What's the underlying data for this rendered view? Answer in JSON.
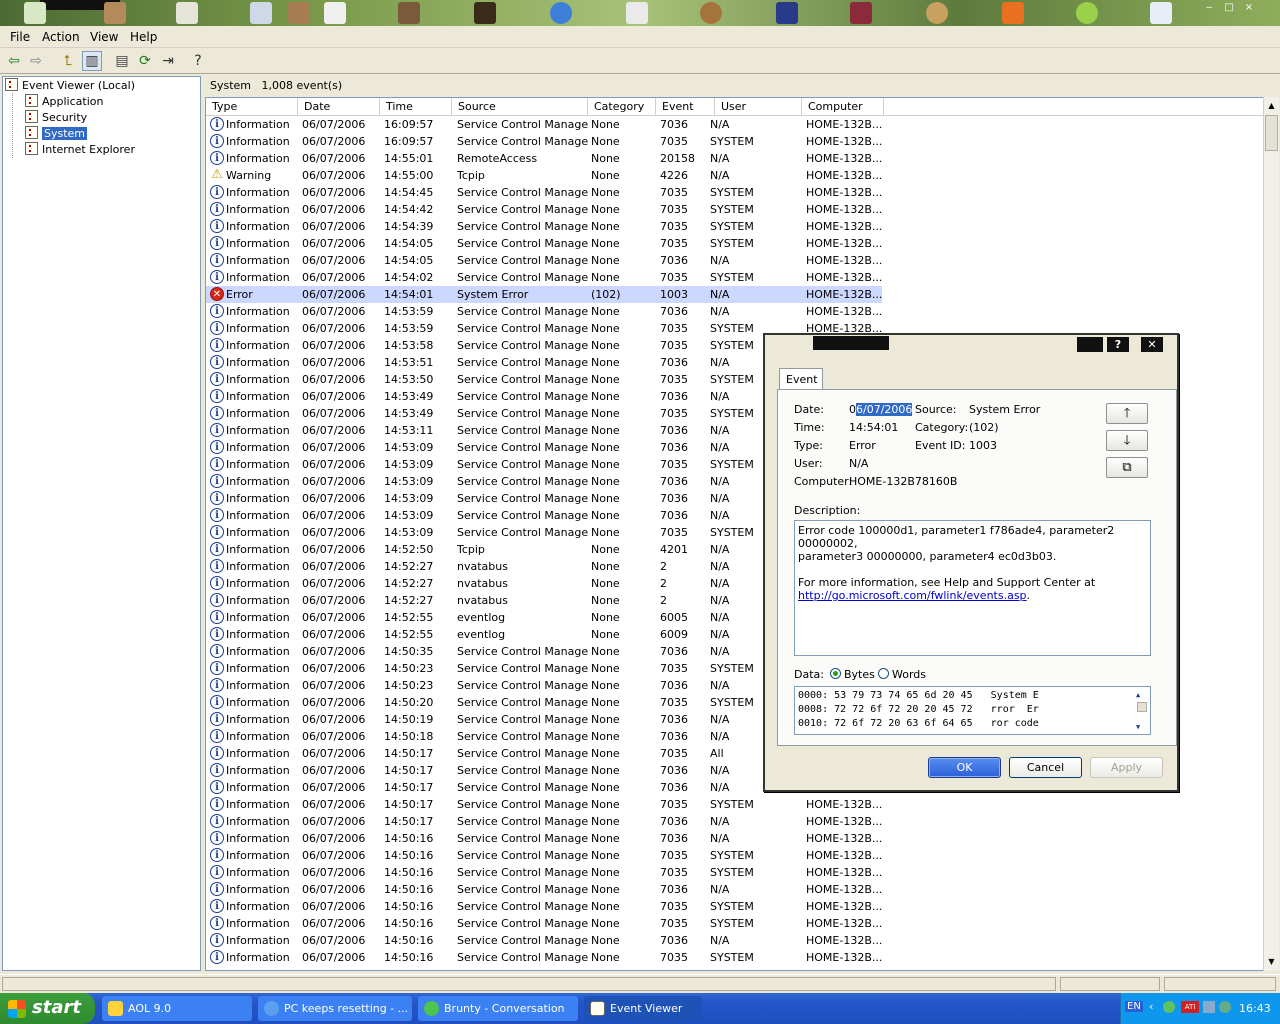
{
  "menu": {
    "file": "File",
    "action": "Action",
    "view": "View",
    "help": "Help"
  },
  "toolbar_icons": [
    "back-arrow-icon",
    "forward-arrow-icon",
    "up-folder-icon",
    "show-hide-tree-icon",
    "properties-icon",
    "refresh-icon",
    "export-list-icon",
    "help-icon"
  ],
  "tree": {
    "root": "Event Viewer (Local)",
    "items": [
      {
        "label": "Application"
      },
      {
        "label": "Security"
      },
      {
        "label": "System"
      },
      {
        "label": "Internet Explorer"
      }
    ]
  },
  "panel": {
    "name": "System",
    "count": "1,008 event(s)"
  },
  "columns": {
    "type": "Type",
    "date": "Date",
    "time": "Time",
    "source": "Source",
    "category": "Category",
    "event": "Event",
    "user": "User",
    "computer": "Computer"
  },
  "events": [
    [
      "info",
      "Information",
      "06/07/2006",
      "16:09:57",
      "Service Control Manager",
      "None",
      "7036",
      "N/A",
      "HOME-132B..."
    ],
    [
      "info",
      "Information",
      "06/07/2006",
      "16:09:57",
      "Service Control Manager",
      "None",
      "7035",
      "SYSTEM",
      "HOME-132B..."
    ],
    [
      "info",
      "Information",
      "06/07/2006",
      "14:55:01",
      "RemoteAccess",
      "None",
      "20158",
      "N/A",
      "HOME-132B..."
    ],
    [
      "warn",
      "Warning",
      "06/07/2006",
      "14:55:00",
      "Tcpip",
      "None",
      "4226",
      "N/A",
      "HOME-132B..."
    ],
    [
      "info",
      "Information",
      "06/07/2006",
      "14:54:45",
      "Service Control Manager",
      "None",
      "7035",
      "SYSTEM",
      "HOME-132B..."
    ],
    [
      "info",
      "Information",
      "06/07/2006",
      "14:54:42",
      "Service Control Manager",
      "None",
      "7035",
      "SYSTEM",
      "HOME-132B..."
    ],
    [
      "info",
      "Information",
      "06/07/2006",
      "14:54:39",
      "Service Control Manager",
      "None",
      "7035",
      "SYSTEM",
      "HOME-132B..."
    ],
    [
      "info",
      "Information",
      "06/07/2006",
      "14:54:05",
      "Service Control Manager",
      "None",
      "7035",
      "SYSTEM",
      "HOME-132B..."
    ],
    [
      "info",
      "Information",
      "06/07/2006",
      "14:54:05",
      "Service Control Manager",
      "None",
      "7036",
      "N/A",
      "HOME-132B..."
    ],
    [
      "info",
      "Information",
      "06/07/2006",
      "14:54:02",
      "Service Control Manager",
      "None",
      "7035",
      "SYSTEM",
      "HOME-132B..."
    ],
    [
      "err",
      "Error",
      "06/07/2006",
      "14:54:01",
      "System Error",
      "(102)",
      "1003",
      "N/A",
      "HOME-132B..."
    ],
    [
      "info",
      "Information",
      "06/07/2006",
      "14:53:59",
      "Service Control Manager",
      "None",
      "7036",
      "N/A",
      "HOME-132B..."
    ],
    [
      "info",
      "Information",
      "06/07/2006",
      "14:53:59",
      "Service Control Manager",
      "None",
      "7035",
      "SYSTEM",
      "HOME-132B..."
    ],
    [
      "info",
      "Information",
      "06/07/2006",
      "14:53:58",
      "Service Control Manager",
      "None",
      "7035",
      "SYSTEM",
      ""
    ],
    [
      "info",
      "Information",
      "06/07/2006",
      "14:53:51",
      "Service Control Manager",
      "None",
      "7036",
      "N/A",
      ""
    ],
    [
      "info",
      "Information",
      "06/07/2006",
      "14:53:50",
      "Service Control Manager",
      "None",
      "7035",
      "SYSTEM",
      ""
    ],
    [
      "info",
      "Information",
      "06/07/2006",
      "14:53:49",
      "Service Control Manager",
      "None",
      "7036",
      "N/A",
      ""
    ],
    [
      "info",
      "Information",
      "06/07/2006",
      "14:53:49",
      "Service Control Manager",
      "None",
      "7035",
      "SYSTEM",
      ""
    ],
    [
      "info",
      "Information",
      "06/07/2006",
      "14:53:11",
      "Service Control Manager",
      "None",
      "7036",
      "N/A",
      ""
    ],
    [
      "info",
      "Information",
      "06/07/2006",
      "14:53:09",
      "Service Control Manager",
      "None",
      "7036",
      "N/A",
      ""
    ],
    [
      "info",
      "Information",
      "06/07/2006",
      "14:53:09",
      "Service Control Manager",
      "None",
      "7035",
      "SYSTEM",
      ""
    ],
    [
      "info",
      "Information",
      "06/07/2006",
      "14:53:09",
      "Service Control Manager",
      "None",
      "7036",
      "N/A",
      ""
    ],
    [
      "info",
      "Information",
      "06/07/2006",
      "14:53:09",
      "Service Control Manager",
      "None",
      "7036",
      "N/A",
      ""
    ],
    [
      "info",
      "Information",
      "06/07/2006",
      "14:53:09",
      "Service Control Manager",
      "None",
      "7036",
      "N/A",
      ""
    ],
    [
      "info",
      "Information",
      "06/07/2006",
      "14:53:09",
      "Service Control Manager",
      "None",
      "7035",
      "SYSTEM",
      ""
    ],
    [
      "info",
      "Information",
      "06/07/2006",
      "14:52:50",
      "Tcpip",
      "None",
      "4201",
      "N/A",
      ""
    ],
    [
      "info",
      "Information",
      "06/07/2006",
      "14:52:27",
      "nvatabus",
      "None",
      "2",
      "N/A",
      ""
    ],
    [
      "info",
      "Information",
      "06/07/2006",
      "14:52:27",
      "nvatabus",
      "None",
      "2",
      "N/A",
      ""
    ],
    [
      "info",
      "Information",
      "06/07/2006",
      "14:52:27",
      "nvatabus",
      "None",
      "2",
      "N/A",
      ""
    ],
    [
      "info",
      "Information",
      "06/07/2006",
      "14:52:55",
      "eventlog",
      "None",
      "6005",
      "N/A",
      ""
    ],
    [
      "info",
      "Information",
      "06/07/2006",
      "14:52:55",
      "eventlog",
      "None",
      "6009",
      "N/A",
      ""
    ],
    [
      "info",
      "Information",
      "06/07/2006",
      "14:50:35",
      "Service Control Manager",
      "None",
      "7036",
      "N/A",
      ""
    ],
    [
      "info",
      "Information",
      "06/07/2006",
      "14:50:23",
      "Service Control Manager",
      "None",
      "7035",
      "SYSTEM",
      ""
    ],
    [
      "info",
      "Information",
      "06/07/2006",
      "14:50:23",
      "Service Control Manager",
      "None",
      "7036",
      "N/A",
      ""
    ],
    [
      "info",
      "Information",
      "06/07/2006",
      "14:50:20",
      "Service Control Manager",
      "None",
      "7035",
      "SYSTEM",
      ""
    ],
    [
      "info",
      "Information",
      "06/07/2006",
      "14:50:19",
      "Service Control Manager",
      "None",
      "7036",
      "N/A",
      ""
    ],
    [
      "info",
      "Information",
      "06/07/2006",
      "14:50:18",
      "Service Control Manager",
      "None",
      "7036",
      "N/A",
      ""
    ],
    [
      "info",
      "Information",
      "06/07/2006",
      "14:50:17",
      "Service Control Manager",
      "None",
      "7035",
      "All",
      ""
    ],
    [
      "info",
      "Information",
      "06/07/2006",
      "14:50:17",
      "Service Control Manager",
      "None",
      "7036",
      "N/A",
      ""
    ],
    [
      "info",
      "Information",
      "06/07/2006",
      "14:50:17",
      "Service Control Manager",
      "None",
      "7036",
      "N/A",
      ""
    ],
    [
      "info",
      "Information",
      "06/07/2006",
      "14:50:17",
      "Service Control Manager",
      "None",
      "7035",
      "SYSTEM",
      "HOME-132B..."
    ],
    [
      "info",
      "Information",
      "06/07/2006",
      "14:50:17",
      "Service Control Manager",
      "None",
      "7036",
      "N/A",
      "HOME-132B..."
    ],
    [
      "info",
      "Information",
      "06/07/2006",
      "14:50:16",
      "Service Control Manager",
      "None",
      "7036",
      "N/A",
      "HOME-132B..."
    ],
    [
      "info",
      "Information",
      "06/07/2006",
      "14:50:16",
      "Service Control Manager",
      "None",
      "7035",
      "SYSTEM",
      "HOME-132B..."
    ],
    [
      "info",
      "Information",
      "06/07/2006",
      "14:50:16",
      "Service Control Manager",
      "None",
      "7035",
      "SYSTEM",
      "HOME-132B..."
    ],
    [
      "info",
      "Information",
      "06/07/2006",
      "14:50:16",
      "Service Control Manager",
      "None",
      "7036",
      "N/A",
      "HOME-132B..."
    ],
    [
      "info",
      "Information",
      "06/07/2006",
      "14:50:16",
      "Service Control Manager",
      "None",
      "7035",
      "SYSTEM",
      "HOME-132B..."
    ],
    [
      "info",
      "Information",
      "06/07/2006",
      "14:50:16",
      "Service Control Manager",
      "None",
      "7035",
      "SYSTEM",
      "HOME-132B..."
    ],
    [
      "info",
      "Information",
      "06/07/2006",
      "14:50:16",
      "Service Control Manager",
      "None",
      "7036",
      "N/A",
      "HOME-132B..."
    ],
    [
      "info",
      "Information",
      "06/07/2006",
      "14:50:16",
      "Service Control Manager",
      "None",
      "7035",
      "SYSTEM",
      "HOME-132B..."
    ]
  ],
  "selected_row": 10,
  "dialog": {
    "tab": "Event",
    "date_label": "Date:",
    "date_value_a": "0",
    "date_value_b": "6/07/2006",
    "source_label": "Source:",
    "source_value": "System Error",
    "time_label": "Time:",
    "time_value": "14:54:01",
    "category_label": "Category:",
    "category_value": "(102)",
    "type_label": "Type:",
    "type_value": "Error",
    "eventid_label": "Event ID:",
    "eventid_value": "1003",
    "user_label": "User:",
    "user_value": "N/A",
    "computer_label": "Computer:",
    "computer_value": "HOME-132B78160B",
    "description_label": "Description:",
    "description_line1": "Error code 100000d1, parameter1 f786ade4, parameter2 00000002,",
    "description_line2": "parameter3 00000000, parameter4 ec0d3b03.",
    "description_line3": "For more information, see Help and Support Center at",
    "description_link": "http://go.microsoft.com/fwlink/events.asp",
    "description_end": ".",
    "data_label": "Data:",
    "bytes_label": "Bytes",
    "words_label": "Words",
    "hex_lines": [
      "0000: 53 79 73 74 65 6d 20 45   System E",
      "0008: 72 72 6f 72 20 20 45 72   rror  Er",
      "0010: 72 6f 72 20 63 6f 64 65   ror code"
    ],
    "ok": "OK",
    "cancel": "Cancel",
    "apply": "Apply"
  },
  "taskbar": {
    "start": "start",
    "tasks": [
      {
        "label": "AOL 9.0"
      },
      {
        "label": "PC keeps resetting - ..."
      },
      {
        "label": "Brunty - Conversation"
      },
      {
        "label": "Event Viewer"
      }
    ],
    "lang": "EN",
    "clock": "16:43"
  }
}
